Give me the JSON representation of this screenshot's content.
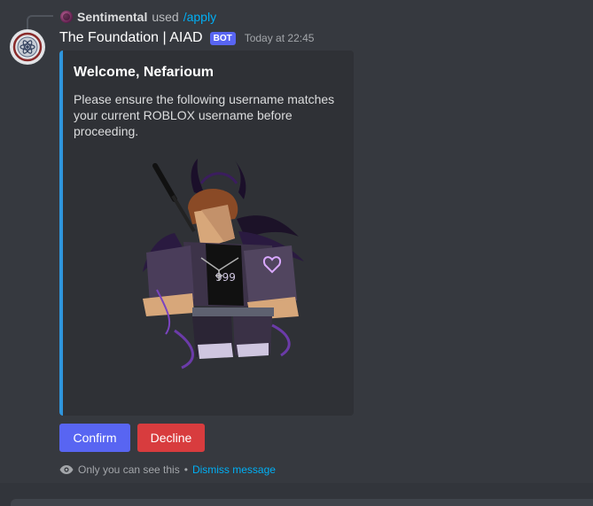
{
  "command_reply": {
    "user": "Sentimental",
    "used_text": "used",
    "command": "/apply"
  },
  "message": {
    "author": "The Foundation | AIAD",
    "tag": "BOT",
    "timestamp": "Today at 22:45"
  },
  "embed": {
    "accent_color": "#2f95dc",
    "title": "Welcome, Nefarioum",
    "description": "Please ensure the following username matches your current ROBLOX username before proceeding."
  },
  "buttons": {
    "confirm": "Confirm",
    "decline": "Decline"
  },
  "ephemeral": {
    "note": "Only you can see this",
    "separator": "•",
    "dismiss": "Dismiss message"
  },
  "colors": {
    "background": "#36393f",
    "blurple": "#5865f2",
    "danger": "#d83c3e",
    "link": "#00aff4"
  }
}
